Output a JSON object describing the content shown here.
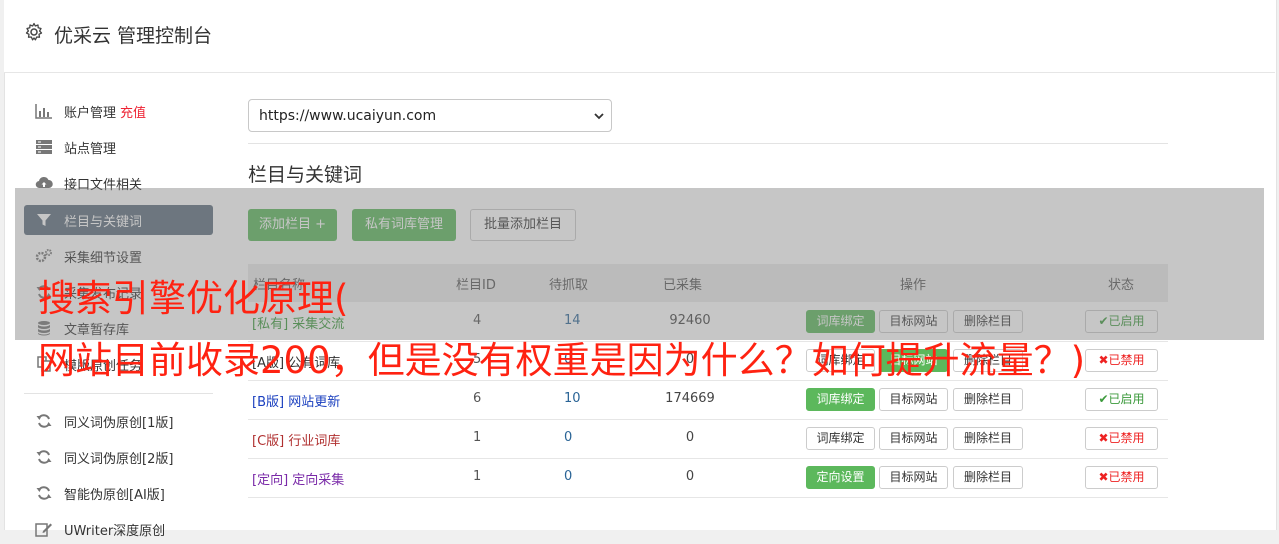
{
  "header": {
    "title": "优采云 管理控制台"
  },
  "sidebar": {
    "items": [
      {
        "label": "账户管理",
        "highlight": "充值",
        "icon": "bar-chart-icon"
      },
      {
        "label": "站点管理",
        "icon": "server-icon"
      },
      {
        "label": "接口文件相关",
        "icon": "cloud-upload-icon"
      },
      {
        "label": "栏目与关键词",
        "icon": "filter-icon",
        "active": true
      },
      {
        "label": "采集细节设置",
        "icon": "gears-icon"
      },
      {
        "label": "采集发布记录",
        "icon": "refresh-icon"
      },
      {
        "label": "文章暂存库",
        "icon": "database-icon"
      },
      {
        "label": "模版原创任务",
        "icon": "copy-icon"
      },
      {
        "label": "同义词伪原创[1版]",
        "icon": "refresh-icon"
      },
      {
        "label": "同义词伪原创[2版]",
        "icon": "refresh-icon"
      },
      {
        "label": "智能伪原创[AI版]",
        "icon": "refresh-icon"
      },
      {
        "label": "UWriter深度原创",
        "icon": "edit-icon"
      }
    ]
  },
  "site_select": {
    "value": "https://www.ucaiyun.com"
  },
  "section": {
    "title": "栏目与关键词"
  },
  "toolbar": {
    "add_label": "添加栏目 +",
    "private_label": "私有词库管理",
    "batch_label": "批量添加栏目"
  },
  "table": {
    "headers": {
      "name": "栏目名称",
      "id": "栏目ID",
      "pending": "待抓取",
      "collected": "已采集",
      "ops": "操作",
      "status": "状态"
    },
    "rows": [
      {
        "tag": "[私有]",
        "name": "采集交流",
        "id": "4",
        "pending": "14",
        "collected": "92460",
        "op1": "词库绑定",
        "op1_primary": true,
        "op2": "目标网站",
        "op3": "删除栏目",
        "status": "✔已启用",
        "enabled": true,
        "color": "#3a9a3a"
      },
      {
        "tag": "[A版]",
        "name": "公有词库",
        "id": "5",
        "pending": "0",
        "collected": "0",
        "op1": "词库绑定",
        "op1_primary": false,
        "op2": "目标网站",
        "op2_primary": true,
        "op3": "删除栏目",
        "status": "✖已禁用",
        "enabled": false,
        "color": "#333333"
      },
      {
        "tag": "[B版]",
        "name": "网站更新",
        "id": "6",
        "pending": "10",
        "collected": "174669",
        "op1": "词库绑定",
        "op1_primary": true,
        "op2": "目标网站",
        "op3": "删除栏目",
        "status": "✔已启用",
        "enabled": true,
        "color": "#1a3fbf"
      },
      {
        "tag": "[C版]",
        "name": "行业词库",
        "id": "1",
        "pending": "0",
        "collected": "0",
        "op1": "词库绑定",
        "op1_primary": false,
        "op2": "目标网站",
        "op3": "删除栏目",
        "status": "✖已禁用",
        "enabled": false,
        "color": "#b03030"
      },
      {
        "tag": "[定向]",
        "name": "定向采集",
        "id": "1",
        "pending": "0",
        "collected": "0",
        "op1": "定向设置",
        "op1_primary": true,
        "op2": "目标网站",
        "op3": "删除栏目",
        "status": "✖已禁用",
        "enabled": false,
        "color": "#7a2aa8"
      }
    ]
  },
  "watermark": {
    "line1": "搜索引擎优化原理(",
    "line2": "网站目前收录200，但是没有权重是因为什么？如何提升流量？)"
  },
  "colors": {
    "primary_green": "#5cb85c",
    "active_nav": "#5e6e7e",
    "watermark_red": "#ff2211"
  }
}
